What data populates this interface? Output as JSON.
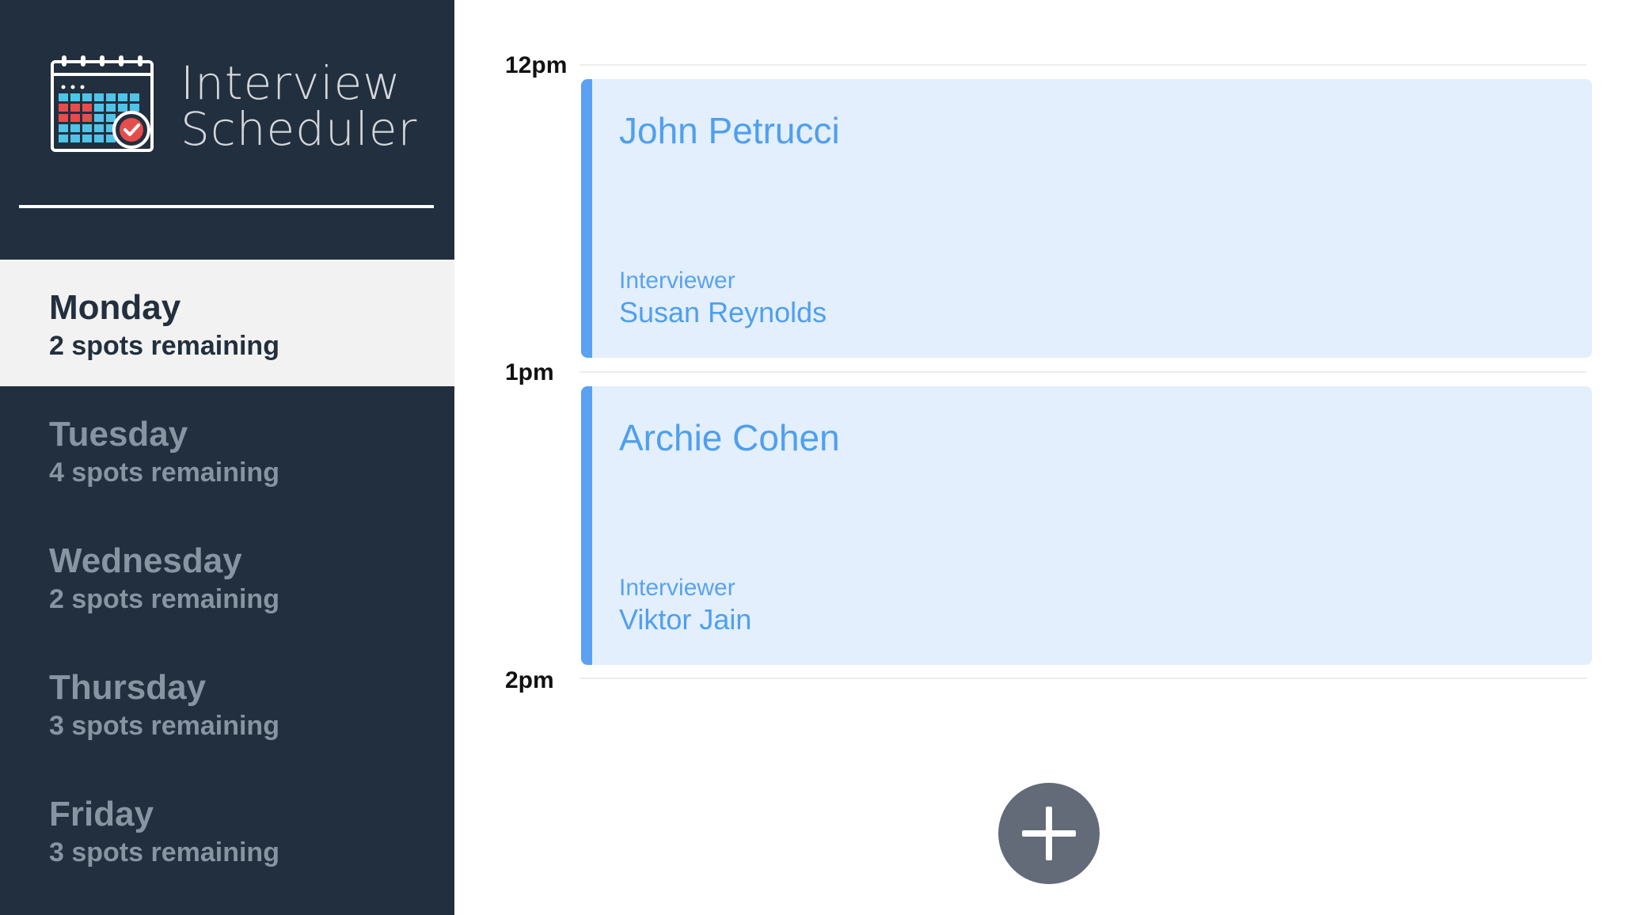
{
  "app": {
    "title_line1": "Interview",
    "title_line2": "Scheduler"
  },
  "days": [
    {
      "name": "Monday",
      "spots": "2 spots remaining",
      "selected": true
    },
    {
      "name": "Tuesday",
      "spots": "4 spots remaining",
      "selected": false
    },
    {
      "name": "Wednesday",
      "spots": "2 spots remaining",
      "selected": false
    },
    {
      "name": "Thursday",
      "spots": "3 spots remaining",
      "selected": false
    },
    {
      "name": "Friday",
      "spots": "3 spots remaining",
      "selected": false
    }
  ],
  "schedule": {
    "times": [
      "12pm",
      "1pm",
      "2pm"
    ],
    "appointments": [
      {
        "student": "John Petrucci",
        "interviewer_label": "Interviewer",
        "interviewer": "Susan Reynolds"
      },
      {
        "student": "Archie Cohen",
        "interviewer_label": "Interviewer",
        "interviewer": "Viktor Jain"
      }
    ],
    "add_icon": "plus-icon"
  },
  "colors": {
    "sidebar_bg": "#222f3e",
    "selected_bg": "#f2f2f2",
    "appointment_bg": "#e3effc",
    "appointment_accent": "#5aa2f1",
    "add_button_bg": "#636a78"
  }
}
